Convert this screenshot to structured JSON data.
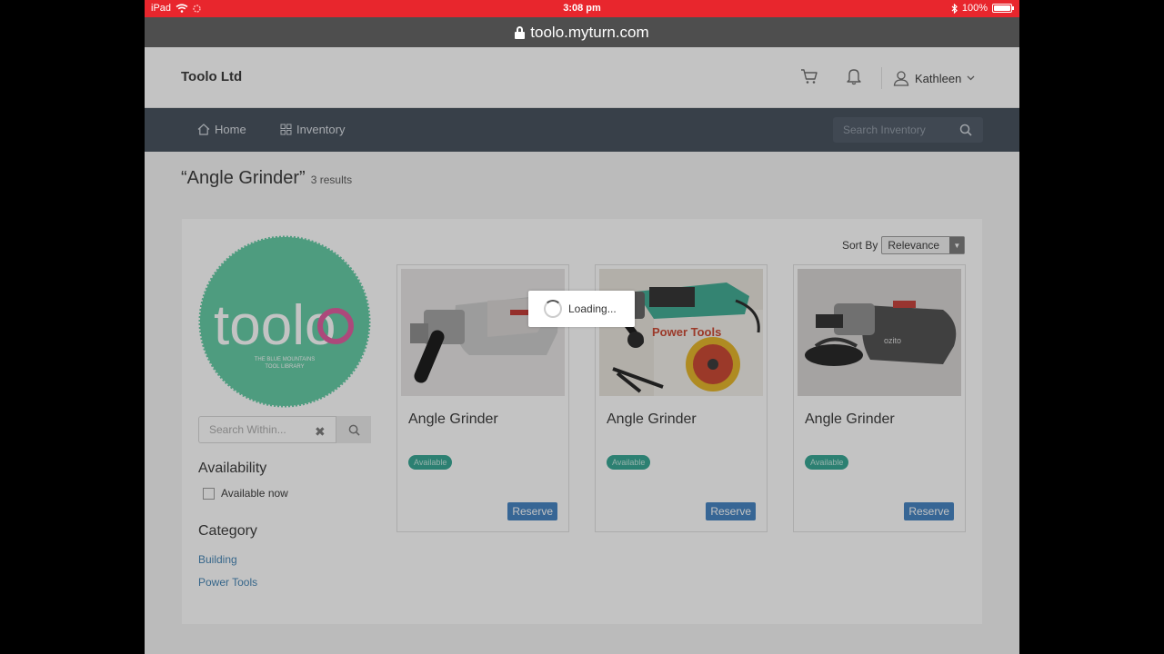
{
  "status_bar": {
    "device": "iPad",
    "time": "3:08 pm",
    "battery": "100%"
  },
  "browser": {
    "url": "toolo.myturn.com"
  },
  "header": {
    "brand": "Toolo Ltd",
    "user_name": "Kathleen"
  },
  "nav": {
    "home": "Home",
    "inventory": "Inventory",
    "search_placeholder": "Search Inventory"
  },
  "results": {
    "query": "“Angle Grinder”",
    "count": "3 results"
  },
  "sidebar": {
    "logo_text": "toolo",
    "logo_tagline_1": "THE BLUE MOUNTAINS",
    "logo_tagline_2": "TOOL LIBRARY",
    "search_placeholder": "Search Within...",
    "availability_heading": "Availability",
    "available_now": "Available now",
    "category_heading": "Category",
    "categories": [
      "Building",
      "Power Tools"
    ]
  },
  "sort": {
    "label": "Sort By",
    "value": "Relevance"
  },
  "items": [
    {
      "title": "Angle Grinder",
      "status": "Available",
      "action": "Reserve"
    },
    {
      "title": "Angle Grinder",
      "status": "Available",
      "action": "Reserve",
      "box_text": "Power Tools"
    },
    {
      "title": "Angle Grinder",
      "status": "Available",
      "action": "Reserve",
      "brand_text": "ozito"
    }
  ],
  "loading": {
    "text": "Loading..."
  },
  "colors": {
    "status_bar": "#e8262d",
    "navbar": "#3f4a57",
    "link": "#3c7fb1",
    "badge": "#2fa38f",
    "reserve": "#3d7fc0",
    "logo": "#5ec9a1",
    "logo_accent": "#e0569b"
  }
}
